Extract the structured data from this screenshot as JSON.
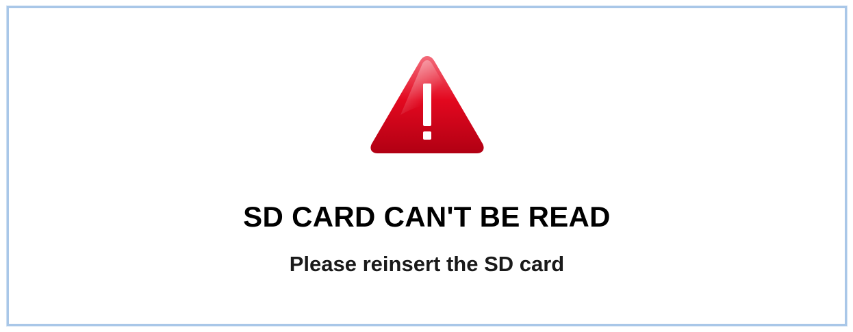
{
  "dialog": {
    "icon": "warning-triangle-icon",
    "title": "SD CARD CAN'T BE READ",
    "message": "Please reinsert the SD card"
  },
  "colors": {
    "border": "#a9c7e8",
    "icon_red": "#e0001b",
    "icon_dark_red": "#a8000f",
    "text": "#000000"
  }
}
